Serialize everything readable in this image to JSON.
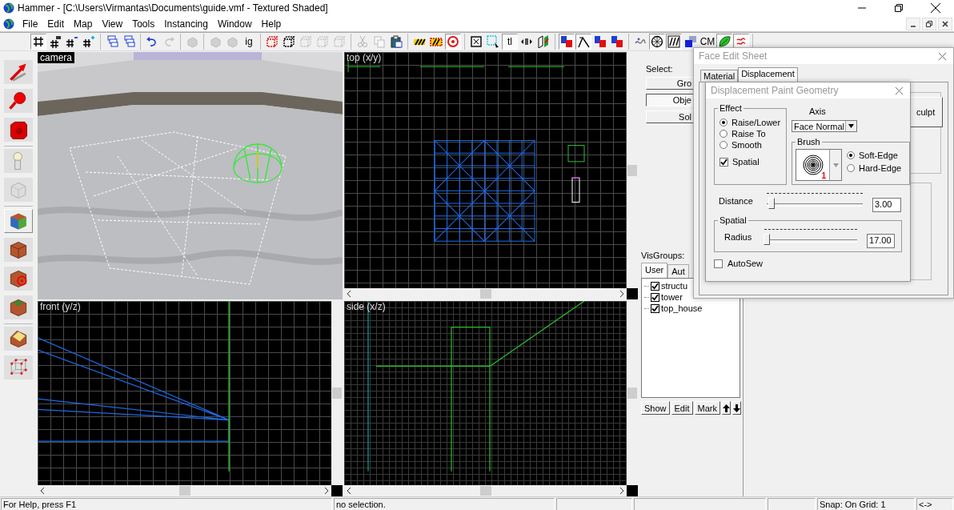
{
  "window": {
    "title": "Hammer - [C:\\Users\\Virmantas\\Documents\\guide.vmf - Textured Shaded]"
  },
  "menu": [
    "File",
    "Edit",
    "Map",
    "View",
    "Tools",
    "Instancing",
    "Window",
    "Help"
  ],
  "toolbar": [
    [
      {
        "kind": "grid",
        "pressed": true,
        "disabled": false
      },
      {
        "kind": "grid-3d",
        "pressed": false,
        "disabled": false
      },
      {
        "kind": "grid-minus",
        "pressed": false,
        "disabled": false
      },
      {
        "kind": "grid-plus",
        "pressed": false,
        "disabled": false
      }
    ],
    [
      {
        "kind": "group",
        "pressed": false,
        "disabled": false
      },
      {
        "kind": "group",
        "pressed": false,
        "disabled": false
      }
    ],
    [
      {
        "kind": "undo",
        "pressed": false,
        "disabled": false
      },
      {
        "kind": "redo",
        "pressed": false,
        "disabled": true
      }
    ],
    [
      {
        "kind": "block",
        "pressed": false,
        "disabled": true
      }
    ],
    [
      {
        "kind": "block",
        "pressed": false,
        "disabled": true
      },
      {
        "kind": "block",
        "pressed": false,
        "disabled": true
      },
      {
        "kind": "text",
        "label": "ig",
        "pressed": false,
        "disabled": false
      }
    ],
    [
      {
        "kind": "cube-red",
        "pressed": false,
        "disabled": false
      },
      {
        "kind": "cube-outline",
        "pressed": false,
        "disabled": false
      },
      {
        "kind": "cube-outline",
        "pressed": false,
        "disabled": true
      },
      {
        "kind": "cube-outline",
        "pressed": false,
        "disabled": true
      },
      {
        "kind": "cube-outline",
        "pressed": false,
        "disabled": true
      }
    ],
    [
      {
        "kind": "cut",
        "pressed": false,
        "disabled": true
      },
      {
        "kind": "copy",
        "pressed": false,
        "disabled": true
      },
      {
        "kind": "paste",
        "pressed": false,
        "disabled": false
      }
    ],
    [
      {
        "kind": "stripes",
        "pressed": false,
        "disabled": false
      },
      {
        "kind": "stripes-red",
        "pressed": false,
        "disabled": false
      },
      {
        "kind": "ring",
        "pressed": true,
        "disabled": false
      }
    ],
    [
      {
        "kind": "select-box",
        "pressed": false,
        "disabled": false
      },
      {
        "kind": "select-cyan",
        "pressed": false,
        "disabled": false
      },
      {
        "kind": "text",
        "label": "tl",
        "pressed": true,
        "disabled": false
      },
      {
        "kind": "arrows",
        "pressed": false,
        "disabled": false
      },
      {
        "kind": "flip",
        "pressed": false,
        "disabled": false
      }
    ],
    [
      {
        "kind": "blocks-red",
        "pressed": true,
        "disabled": false
      },
      {
        "kind": "arc",
        "pressed": true,
        "disabled": false
      },
      {
        "kind": "blocks-red",
        "pressed": false,
        "disabled": false
      },
      {
        "kind": "blocks-red",
        "pressed": false,
        "disabled": false
      }
    ],
    [
      {
        "kind": "squiggle",
        "pressed": false,
        "disabled": false
      },
      {
        "kind": "sphere",
        "pressed": true,
        "disabled": false
      },
      {
        "kind": "hatch",
        "pressed": true,
        "disabled": false
      },
      {
        "kind": "squares",
        "pressed": false,
        "disabled": false
      },
      {
        "kind": "text",
        "label": "CM",
        "pressed": false,
        "disabled": false
      },
      {
        "kind": "leaf",
        "pressed": true,
        "disabled": false
      },
      {
        "kind": "nodraw",
        "pressed": true,
        "disabled": false
      }
    ]
  ],
  "tools": [
    [
      {
        "kind": "pointer",
        "selected": false
      },
      {
        "kind": "magnifier",
        "selected": false
      },
      {
        "kind": "camera",
        "selected": false
      }
    ],
    [
      {
        "kind": "entity",
        "selected": false
      },
      {
        "kind": "block",
        "selected": false
      }
    ],
    [
      {
        "kind": "texture",
        "selected": true
      },
      {
        "kind": "apply",
        "selected": false
      },
      {
        "kind": "decal",
        "selected": false
      },
      {
        "kind": "overlay",
        "selected": false
      }
    ],
    [
      {
        "kind": "clip",
        "selected": false
      },
      {
        "kind": "vertex",
        "selected": false
      }
    ]
  ],
  "viewports": [
    {
      "kind": "camera",
      "label": "camera"
    },
    {
      "kind": "top",
      "label": "top (x/y)"
    },
    {
      "kind": "front",
      "label": "front (y/z)"
    },
    {
      "kind": "side",
      "label": "side (x/z)"
    }
  ],
  "select_panel": {
    "label": "Select:",
    "buttons": [
      {
        "label": "Gro",
        "selected": false
      },
      {
        "label": "Obje",
        "selected": true
      },
      {
        "label": "Sol",
        "selected": false
      }
    ]
  },
  "visgroups": {
    "label": "VisGroups:",
    "tabs": [
      {
        "label": "User",
        "selected": true
      },
      {
        "label": "Aut",
        "selected": false
      }
    ],
    "items": [
      {
        "label": "structu",
        "checked": true
      },
      {
        "label": "tower",
        "checked": true
      },
      {
        "label": "top_house",
        "checked": true
      }
    ],
    "buttons": [
      "Show",
      "Edit",
      "Mark"
    ]
  },
  "face_edit_sheet": {
    "title": "Face Edit Sheet",
    "tabs": [
      {
        "label": "Material",
        "selected": false
      },
      {
        "label": "Displacement",
        "selected": true
      }
    ],
    "button": "culpt"
  },
  "paint_dialog": {
    "title": "Displacement Paint Geometry",
    "effect": {
      "label": "Effect",
      "options": [
        {
          "label": "Raise/Lower",
          "selected": true
        },
        {
          "label": "Raise To",
          "selected": false
        },
        {
          "label": "Smooth",
          "selected": false
        }
      ],
      "spatial": {
        "label": "Spatial",
        "checked": true
      }
    },
    "axis": {
      "label": "Axis",
      "value": "Face Normal"
    },
    "brush": {
      "label": "Brush",
      "number": "1",
      "options": [
        {
          "label": "Soft-Edge",
          "selected": true
        },
        {
          "label": "Hard-Edge",
          "selected": false
        }
      ]
    },
    "distance": {
      "label": "Distance",
      "level": 0.05,
      "value": "3.00"
    },
    "spatial": {
      "label": "Spatial",
      "radius": {
        "label": "Radius",
        "level": 0.02,
        "value": "17.00"
      }
    },
    "autosew": {
      "label": "AutoSew",
      "checked": false
    }
  },
  "status_bar": {
    "help": "For Help, press F1",
    "selection": "no selection.",
    "snap": "Snap: On Grid: 1",
    "mode": "<->"
  }
}
